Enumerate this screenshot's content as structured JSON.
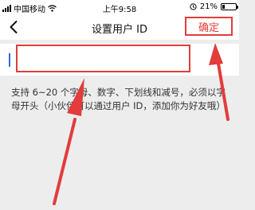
{
  "status_bar": {
    "carrier": "中国移动",
    "time": "上午9:58",
    "battery": "21%",
    "battery_level": 0.21
  },
  "nav": {
    "back_icon": "chevron-left-icon",
    "title": "设置用户 ID",
    "confirm_label": "确定"
  },
  "input": {
    "value": "",
    "placeholder": ""
  },
  "hint": {
    "text": "支持 6~20 个字母、数字、下划线和减号，必须以字母开头（小伙伴可以通过用户 ID，添加你为好友哦）"
  },
  "colors": {
    "annotation_red": "#e23c3c",
    "cursor_blue": "#2a6de0",
    "background": "#ededed"
  }
}
